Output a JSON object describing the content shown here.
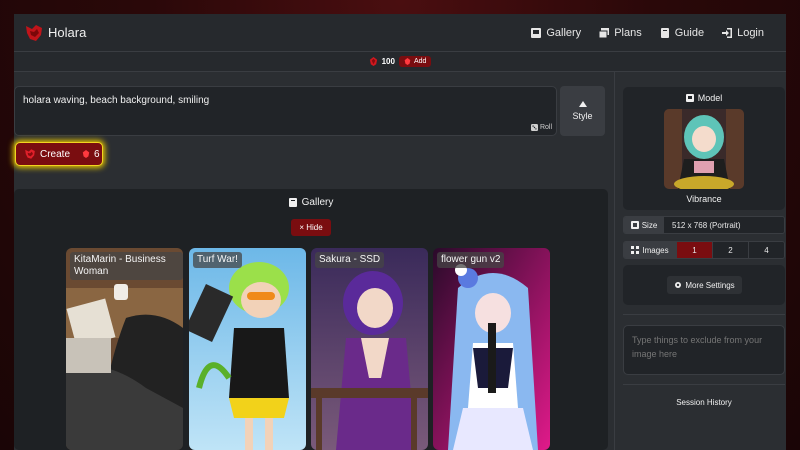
{
  "nav": {
    "brand": "Holara",
    "links": [
      {
        "label": "Gallery",
        "icon": "image-icon"
      },
      {
        "label": "Plans",
        "icon": "stack-icon"
      },
      {
        "label": "Guide",
        "icon": "book-icon"
      },
      {
        "label": "Login",
        "icon": "login-icon"
      }
    ]
  },
  "credits": {
    "count": "100",
    "add_label": "Add"
  },
  "prompt": {
    "text": "holara waving, beach background, smiling",
    "roll_label": "Roll"
  },
  "style_button": {
    "label": "Style"
  },
  "create_button": {
    "label": "Create",
    "cost": "6"
  },
  "gallery": {
    "title": "Gallery",
    "hide_label": "× Hide",
    "cards": [
      {
        "title": "KitaMarin - Business Woman"
      },
      {
        "title": "Turf War!"
      },
      {
        "title": "Sakura - SSD"
      },
      {
        "title": "flower gun v2"
      }
    ]
  },
  "model": {
    "title": "Model",
    "name": "Vibrance"
  },
  "size": {
    "label": "Size",
    "value": "512 x 768 (Portrait)"
  },
  "images": {
    "label": "Images",
    "options": [
      "1",
      "2",
      "4"
    ],
    "selected": "1"
  },
  "settings_button": {
    "label": "More Settings"
  },
  "negative_prompt": {
    "placeholder": "Type things to exclude from your image here"
  },
  "history": {
    "title": "Session History"
  },
  "colors": {
    "accent": "#7a0d10",
    "highlight": "#f3d420",
    "panel": "#212428",
    "background": "#2b2e32"
  }
}
